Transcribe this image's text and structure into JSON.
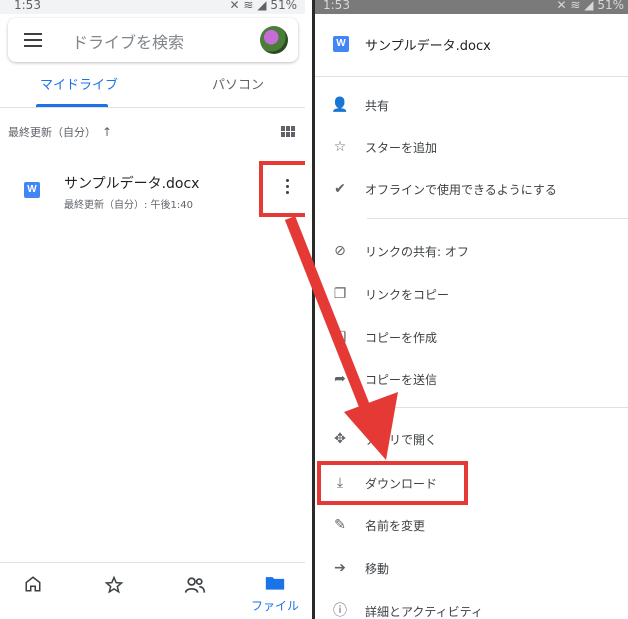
{
  "left": {
    "status": {
      "time": "1:53",
      "indicators": "✕ ≋ ◢ 51%"
    },
    "search": {
      "placeholder": "ドライブを検索"
    },
    "tabs": [
      {
        "label": "マイドライブ"
      },
      {
        "label": "パソコン"
      }
    ],
    "sort_label": "最終更新（自分）",
    "sort_arrow": "↑",
    "file": {
      "icon_letter": "W",
      "name": "サンプルデータ.docx",
      "meta": "最終更新（自分）: 午後1:40"
    },
    "bottom_nav": {
      "files_label": "ファイル"
    }
  },
  "right": {
    "status": {
      "time": "1:53",
      "indicators": "✕ ≋ ◢ 51%"
    },
    "header": {
      "icon_letter": "W",
      "title": "サンプルデータ.docx"
    },
    "menu": [
      {
        "icon": "person-add-icon",
        "glyph": "👤",
        "label": "共有"
      },
      {
        "icon": "star-icon",
        "glyph": "☆",
        "label": "スターを追加"
      },
      {
        "icon": "offline-icon",
        "glyph": "✔",
        "label": "オフラインで使用できるようにする"
      },
      {
        "icon": "link-off-icon",
        "glyph": "⊘",
        "label": "リンクの共有: オフ"
      },
      {
        "icon": "copy-link-icon",
        "glyph": "❐",
        "label": "リンクをコピー"
      },
      {
        "icon": "make-copy-icon",
        "glyph": "❏",
        "label": "コピーを作成"
      },
      {
        "icon": "send-copy-icon",
        "glyph": "➦",
        "label": "コピーを送信"
      },
      {
        "icon": "open-with-icon",
        "glyph": "✥",
        "label": "アプリで開く"
      },
      {
        "icon": "download-icon",
        "glyph": "⤓",
        "label": "ダウンロード"
      },
      {
        "icon": "rename-icon",
        "glyph": "✎",
        "label": "名前を変更"
      },
      {
        "icon": "move-icon",
        "glyph": "➔",
        "label": "移動"
      },
      {
        "icon": "info-icon",
        "glyph": "ⓘ",
        "label": "詳細とアクティビティ"
      }
    ]
  },
  "colors": {
    "accent": "#1a73e8",
    "highlight": "#e53935",
    "word": "#4285f4"
  }
}
